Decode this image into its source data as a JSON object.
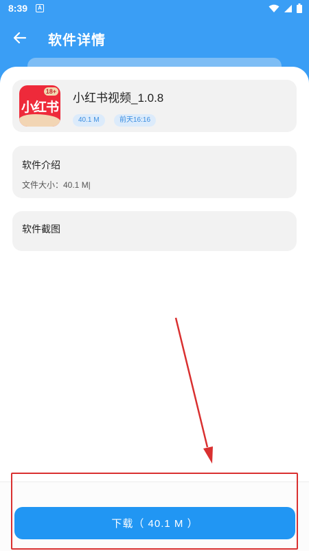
{
  "status_bar": {
    "time": "8:39",
    "notification_glyph": "A",
    "icons": [
      "wifi-icon",
      "signal-icon",
      "battery-icon"
    ]
  },
  "header": {
    "title": "软件详情",
    "back_icon": "arrow-left-icon"
  },
  "app": {
    "name": "小红书视频_1.0.8",
    "icon_text": "小红书",
    "icon_badge": "18+",
    "size_tag": "40.1 M",
    "date_tag": "前天16:16"
  },
  "intro": {
    "title": "软件介绍",
    "file_size_text": "文件大小：40.1 M|"
  },
  "screenshots": {
    "title": "软件截图"
  },
  "download": {
    "label": "下载（ 40.1 M ）"
  },
  "colors": {
    "header_bg": "#3a9ef5",
    "button_bg": "#2196f3",
    "annotation": "#d93030"
  }
}
